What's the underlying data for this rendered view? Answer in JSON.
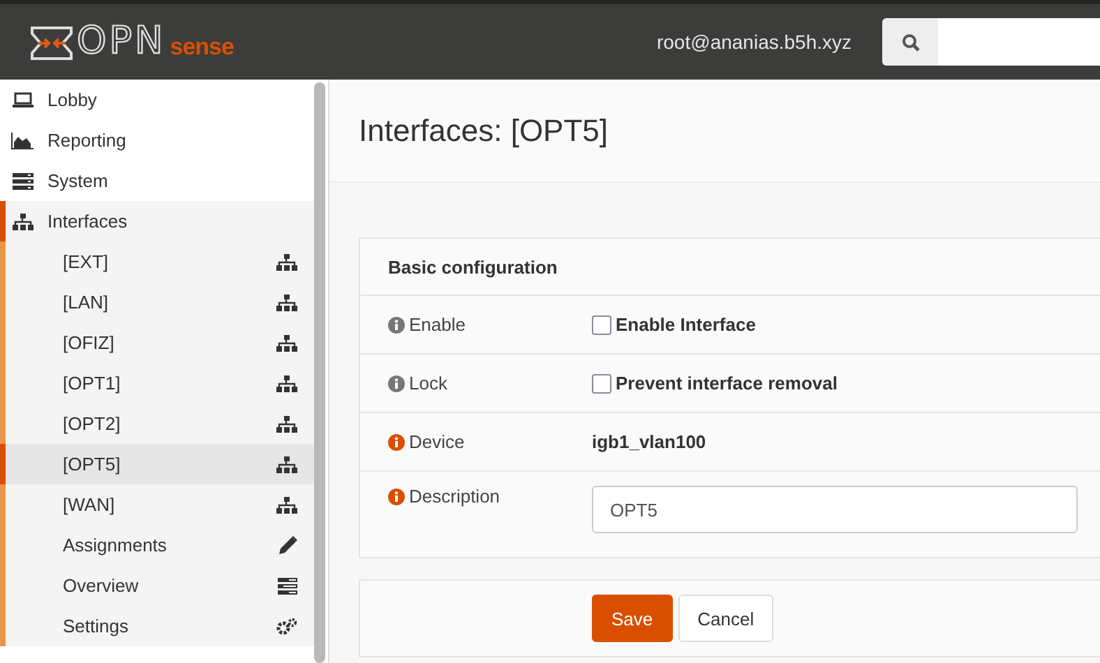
{
  "header": {
    "logo": {
      "main": "OPN",
      "accent": "sense"
    },
    "user": "root@ananias.b5h.xyz"
  },
  "sidebar": {
    "items": [
      {
        "label": "Lobby",
        "selected": false
      },
      {
        "label": "Reporting",
        "selected": false
      },
      {
        "label": "System",
        "selected": false
      },
      {
        "label": "Interfaces",
        "selected": true,
        "expanded": true,
        "children": [
          {
            "label": "[EXT]",
            "kind": "interface",
            "selected": false
          },
          {
            "label": "[LAN]",
            "kind": "interface",
            "selected": false
          },
          {
            "label": "[OFIZ]",
            "kind": "interface",
            "selected": false
          },
          {
            "label": "[OPT1]",
            "kind": "interface",
            "selected": false
          },
          {
            "label": "[OPT2]",
            "kind": "interface",
            "selected": false
          },
          {
            "label": "[OPT5]",
            "kind": "interface",
            "selected": true
          },
          {
            "label": "[WAN]",
            "kind": "interface",
            "selected": false
          },
          {
            "label": "Assignments",
            "kind": "edit",
            "selected": false
          },
          {
            "label": "Overview",
            "kind": "list",
            "selected": false
          },
          {
            "label": "Settings",
            "kind": "settings",
            "selected": false
          }
        ]
      }
    ]
  },
  "page": {
    "title": "Interfaces: [OPT5]",
    "section": {
      "title": "Basic configuration",
      "rows": [
        {
          "kind": "checkbox",
          "label": "Enable",
          "required": false,
          "checked": false,
          "text": "Enable Interface"
        },
        {
          "kind": "checkbox",
          "label": "Lock",
          "required": false,
          "checked": false,
          "text": "Prevent interface removal"
        },
        {
          "kind": "static",
          "label": "Device",
          "required": true,
          "value": "igb1_vlan100"
        },
        {
          "kind": "input",
          "label": "Description",
          "required": true,
          "value": "OPT5"
        }
      ]
    },
    "buttons": [
      {
        "label": "Save",
        "kind": "primary"
      },
      {
        "label": "Cancel",
        "kind": "default"
      }
    ]
  }
}
